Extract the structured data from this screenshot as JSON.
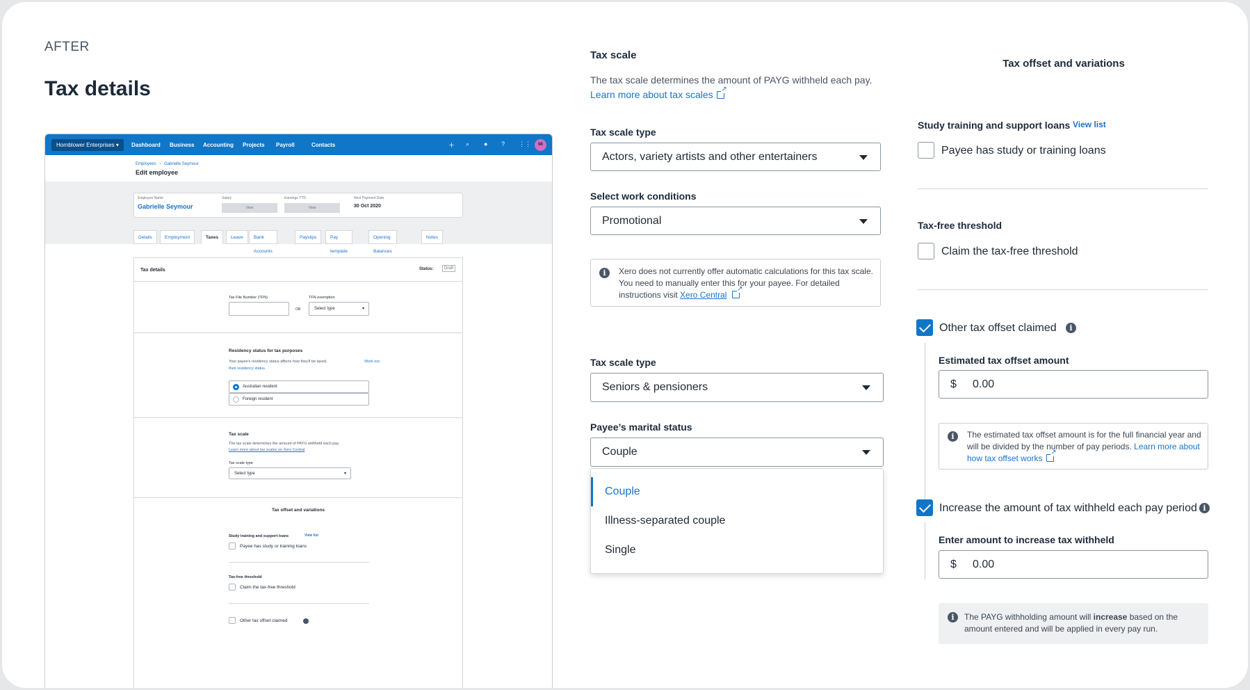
{
  "header": {
    "label": "AFTER",
    "title": "Tax details"
  },
  "mini": {
    "org": "Hornblower Enterprises",
    "nav": [
      "Dashboard",
      "Business",
      "Accounting",
      "Projects",
      "Payroll",
      "Contacts"
    ],
    "avatar": "MI",
    "crumb_1": "Employees",
    "crumb_sep": "›",
    "crumb_2": "Gabrielle Seymour",
    "page_title": "Edit employee",
    "summary": {
      "name_label": "Employee Name",
      "name": "Gabrielle Seymour",
      "salary_label": "Salary",
      "salary_btn": "View",
      "ytd_label": "Earnings YTD",
      "ytd_btn": "View",
      "next_label": "Next Payment Date",
      "next": "30 Oct 2020"
    },
    "tabs": [
      "Details",
      "Employment",
      "Taxes",
      "Leave",
      "Bank Accounts",
      "Payslips",
      "Pay template",
      "Opening Balances",
      "Notes"
    ],
    "form": {
      "title": "Tax details",
      "status_label": "Status:",
      "status": "Draft",
      "tfn_label": "Tax File Number (TFN)",
      "or": "OR",
      "tfn_ex_label": "TFN exemption",
      "tfn_ex_value": "Select type",
      "residency_title": "Residency status for tax purposes",
      "residency_desc": "Your payee's residency status affects how they'll be taxed.",
      "residency_link_1": "Work out",
      "residency_link_2": "their residency status",
      "resident": "Australian resident",
      "foreign": "Foreign resident",
      "scale_title": "Tax scale",
      "scale_desc": "The tax scale determines the amount of PAYG withheld each pay.",
      "scale_link": "Learn more about tax scales on Xero Central",
      "scale_type_label": "Tax scale type",
      "scale_type_value": "Select type",
      "offset_title": "Tax offset and variations",
      "study_label": "Study training and support loans",
      "study_link": "View list",
      "study_cb": "Payee has study or training loans",
      "threshold_label": "Tax-free threshold",
      "threshold_cb": "Claim the tax-free threshold",
      "other_cb": "Other tax offset claimed"
    }
  },
  "tax_scale": {
    "title": "Tax scale",
    "desc": "The tax scale determines the amount of PAYG withheld each pay.",
    "link": "Learn more about tax scales",
    "type_label_1": "Tax scale type",
    "type_value_1": "Actors, variety artists and other entertainers",
    "work_label": "Select work conditions",
    "work_value": "Promotional",
    "info_1": "Xero does not currently offer automatic calculations for this tax scale.",
    "info_2": "You need to manually enter this for your payee. For detailed",
    "info_3_prefix": "instructions visit",
    "info_link": "Xero Central",
    "type_label_2": "Tax scale type",
    "type_value_2": "Seniors & pensioners",
    "marital_label": "Payee’s marital status",
    "marital_value": "Couple",
    "options": [
      "Couple",
      "Illness-separated couple",
      "Single"
    ]
  },
  "offset": {
    "title": "Tax offset and variations",
    "study_label": "Study training and support loans",
    "study_link": "View list",
    "study_cb": "Payee has study or training loans",
    "threshold_label": "Tax-free threshold",
    "threshold_cb": "Claim the tax-free threshold",
    "other_cb": "Other tax offset claimed",
    "est_label": "Estimated tax offset amount",
    "currency": "$",
    "est_value": "0.00",
    "est_info_1": "The estimated tax offset amount is for the full financial year and",
    "est_info_2": "will be divided by the number of pay periods.",
    "est_info_link_1": "Learn more about",
    "est_info_link_2": "how tax offset works",
    "increase_cb": "Increase the amount of tax withheld each pay period",
    "increase_label": "Enter amount to increase tax withheld",
    "increase_value": "0.00",
    "payg_info_1_prefix": "The PAYG withholding amount will",
    "payg_info_bold": "increase",
    "payg_info_1_suffix": "based on the",
    "payg_info_2": "amount entered and will be applied in every pay run."
  },
  "colors": {
    "accent": "#0f76c8",
    "link": "#1a73c9",
    "text": "#1c2a3a"
  }
}
